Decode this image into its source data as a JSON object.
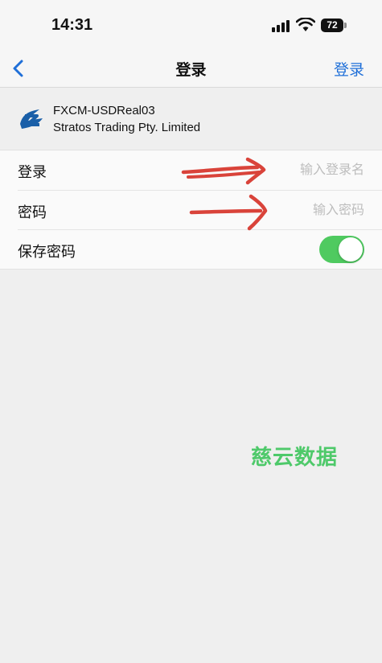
{
  "status_bar": {
    "time": "14:31",
    "battery": "72"
  },
  "nav": {
    "title": "登录",
    "right_action": "登录"
  },
  "server": {
    "name": "FXCM-USDReal03",
    "company": "Stratos Trading Pty. Limited",
    "brand_color": "#1a5fa8"
  },
  "form": {
    "login": {
      "label": "登录",
      "placeholder": "输入登录名"
    },
    "password": {
      "label": "密码",
      "placeholder": "输入密码"
    },
    "save_password": {
      "label": "保存密码",
      "enabled": true
    }
  },
  "colors": {
    "accent": "#1f6fd8",
    "toggle_on": "#4fca60",
    "annotation": "#d9433a"
  },
  "watermark": "慈云数据"
}
